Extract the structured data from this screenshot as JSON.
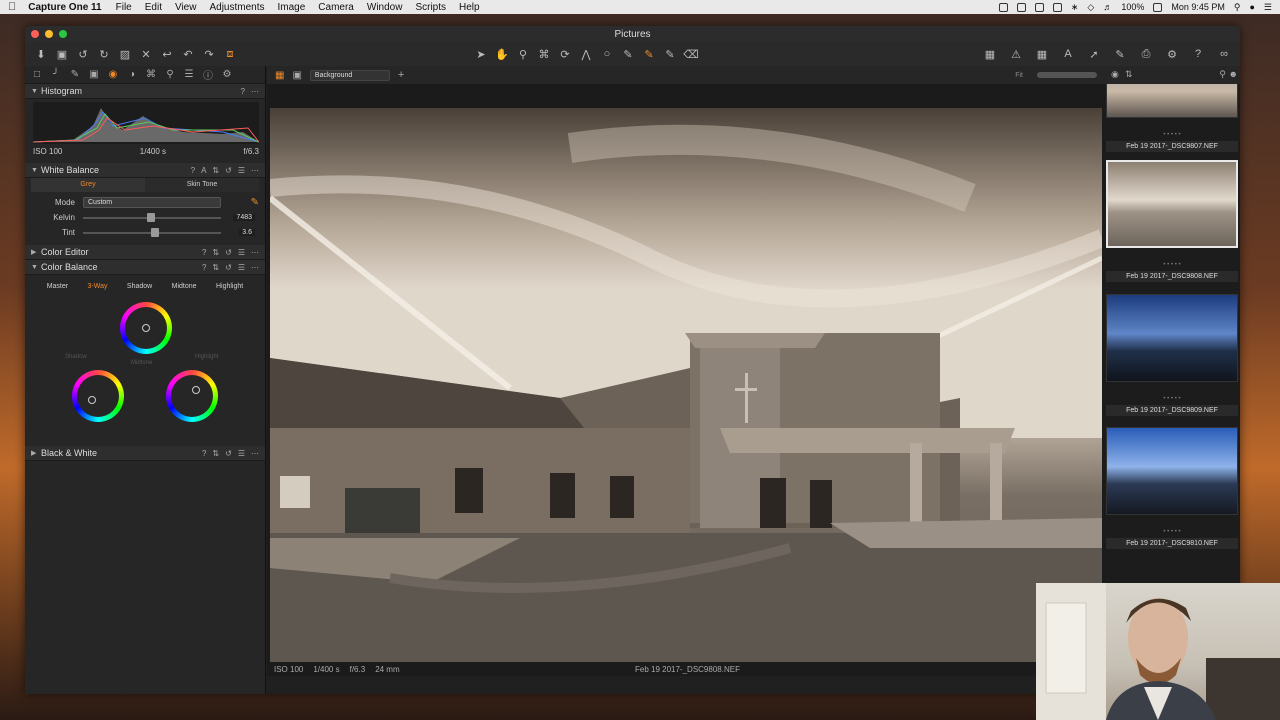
{
  "menubar": {
    "app_name": "Capture One 11",
    "menus": [
      "File",
      "Edit",
      "View",
      "Adjustments",
      "Image",
      "Camera",
      "Window",
      "Scripts",
      "Help"
    ],
    "battery": "100%",
    "clock": "Mon 9:45 PM"
  },
  "window": {
    "title": "Pictures"
  },
  "left_panel": {
    "histogram": {
      "title": "Histogram",
      "iso": "ISO 100",
      "shutter": "1/400 s",
      "aperture": "f/6.3"
    },
    "white_balance": {
      "title": "White Balance",
      "tabs": [
        "Grey",
        "Skin Tone"
      ],
      "mode_label": "Mode",
      "mode_value": "Custom",
      "kelvin_label": "Kelvin",
      "kelvin_value": "7483",
      "tint_label": "Tint",
      "tint_value": "3.6"
    },
    "color_editor": {
      "title": "Color Editor"
    },
    "color_balance": {
      "title": "Color Balance",
      "tabs": [
        "Master",
        "3-Way",
        "Shadow",
        "Midtone",
        "Highlight"
      ],
      "wheel_labels": [
        "Shadow",
        "Midtone",
        "Highlight"
      ]
    },
    "black_white": {
      "title": "Black & White"
    }
  },
  "viewer": {
    "variant_select": "Background",
    "fit_label": "Fit",
    "status": {
      "iso": "ISO 100",
      "shutter": "1/400 s",
      "aperture": "f/6.3",
      "focal": "24 mm",
      "filename": "Feb 19 2017-_DSC9808.NEF"
    }
  },
  "browser": {
    "thumbnails": [
      {
        "name": "Feb 19 2017-_DSC9807.NEF",
        "style": "sky"
      },
      {
        "name": "Feb 19 2017-_DSC9808.NEF",
        "style": "sepia",
        "selected": true
      },
      {
        "name": "Feb 19 2017-_DSC9809.NEF",
        "style": "blue"
      },
      {
        "name": "Feb 19 2017-_DSC9810.NEF",
        "style": "blue"
      }
    ]
  },
  "colors": {
    "accent": "#f08a2a",
    "panel": "#262626",
    "window": "#202020"
  }
}
